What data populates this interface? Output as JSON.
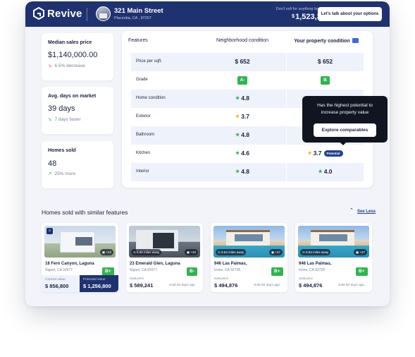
{
  "header": {
    "brand": "Revive",
    "address": "321 Main Street",
    "city": "Placentia, CA , 97207",
    "sell_note": "Don't sell for anything less than",
    "sell_currency": "$",
    "sell_price": "1,523,342",
    "cta": "Let's talk about your options"
  },
  "stats": [
    {
      "label": "Median sales price",
      "value": "$1,140,000.00",
      "delta": "6.5% decrease",
      "trend": "down-red"
    },
    {
      "label": "Avg. days on market",
      "value": "39 days",
      "delta": "7 days faster",
      "trend": "down-green"
    },
    {
      "label": "Homes sold",
      "value": "48",
      "delta": "25% more",
      "trend": "up-green"
    }
  ],
  "table": {
    "col_features": "Features",
    "col_neighborhood": "Neighborhood condition",
    "col_yours": "Your property condition",
    "rows": [
      {
        "label": "Price per sqft.",
        "neighborhood": "$ 652",
        "yours": "$ 652"
      },
      {
        "label": "Grade",
        "neighborhood": "A-",
        "yours": "B"
      },
      {
        "label": "Home condition",
        "neighborhood": "4.8",
        "yours": ""
      },
      {
        "label": "Exterior",
        "neighborhood": "3.7",
        "yours": ""
      },
      {
        "label": "Bathroom",
        "neighborhood": "4.8",
        "yours": ""
      },
      {
        "label": "Kitchen",
        "neighborhood": "4.6",
        "yours": "3.7",
        "chip": "Potential"
      },
      {
        "label": "Interior",
        "neighborhood": "4.8",
        "yours": "4.0"
      }
    ]
  },
  "tooltip": {
    "text": "Has the highest potential to increase property value",
    "button": "Explore comparables"
  },
  "similar": {
    "title": "Homes sold with similar features",
    "toggle": "See Less",
    "cards": [
      {
        "name": "18 Fern Canyon, Laguna",
        "city": "Niguel, CA 92677",
        "grade": "B+",
        "count": "+22",
        "current_label": "Current value",
        "current_value": "$ 856,800",
        "potential_label": "Potential value",
        "potential_value": "$ 1,256,800"
      },
      {
        "name": "23 Emerald Glen, Laguna",
        "city": "Niguel, CA 92677",
        "grade": "B-",
        "miles": "6.56 miles away",
        "count": "+32",
        "sold_label": "Sold price",
        "sold_value": "$ 589,241",
        "sold_ago": "Sold 60 days ago"
      },
      {
        "name": "946 Las Palmas,",
        "city": "Irvine, CA 92728",
        "grade": "B+",
        "miles": "9.63 miles away",
        "count": "+27",
        "sold_label": "Sold price",
        "sold_value": "$ 494,876",
        "sold_ago": "Sold 60 days ago"
      },
      {
        "name": "946 Las Palmas,",
        "city": "Irvine, CA 92728",
        "grade": "B+",
        "miles": "9.63 miles away",
        "count": "+27",
        "sold_label": "Sold price",
        "sold_value": "$ 494,876",
        "sold_ago": "Sold 60 days ago"
      }
    ]
  },
  "colors": {
    "brand_navy": "#1f3270",
    "grade_green": "#2fb550",
    "star_yellow": "#f1b51c",
    "tooltip_bg": "#111521"
  }
}
